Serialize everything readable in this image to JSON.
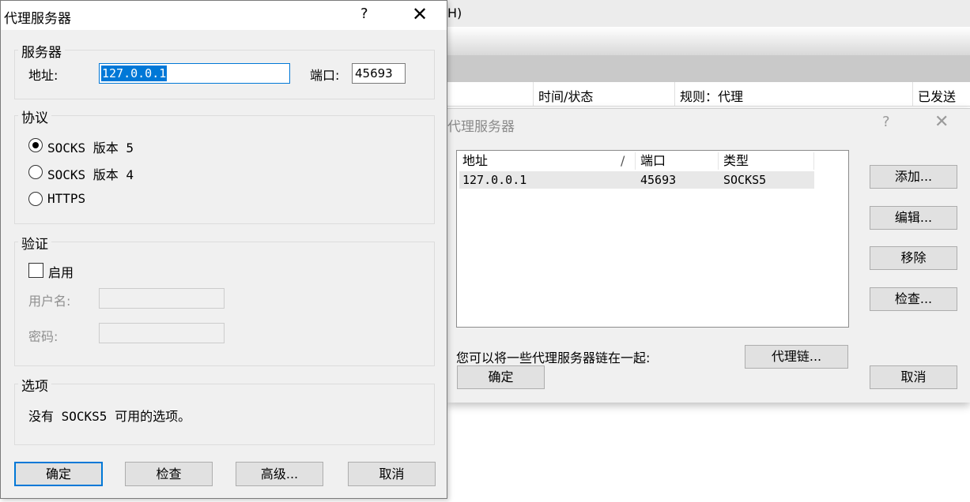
{
  "background_app": {
    "title_fragment": "H)",
    "columns": [
      "时间/状态",
      "规则：代理",
      "已发送"
    ]
  },
  "proxy_list_dialog": {
    "title": "代理服务器",
    "help_icon": "?",
    "close_icon": "✕",
    "table": {
      "headers": [
        "地址",
        "/",
        "端口",
        "类型"
      ],
      "rows": [
        {
          "address": "127.0.0.1",
          "port": "45693",
          "type": "SOCKS5"
        }
      ]
    },
    "buttons": {
      "add": "添加...",
      "edit": "编辑...",
      "remove": "移除",
      "check": "检查..."
    },
    "chain_text": "您可以将一些代理服务器链在一起:",
    "chain_button": "代理链...",
    "ok": "确定",
    "cancel": "取消"
  },
  "proxy_server_dialog": {
    "title": "代理服务器",
    "help_icon": "?",
    "close_icon": "✕",
    "server_group": {
      "legend": "服务器",
      "address_label": "地址:",
      "address_value": "127.0.0.1",
      "port_label": "端口:",
      "port_value": "45693"
    },
    "protocol_group": {
      "legend": "协议",
      "options": [
        "SOCKS 版本 5",
        "SOCKS 版本 4",
        "HTTPS"
      ],
      "selected": "SOCKS 版本 5"
    },
    "auth_group": {
      "legend": "验证",
      "enable_label": "启用",
      "enabled": false,
      "username_label": "用户名:",
      "password_label": "密码:"
    },
    "options_group": {
      "legend": "选项",
      "text": "没有 SOCKS5 可用的选项。"
    },
    "buttons": {
      "ok": "确定",
      "check": "检查",
      "advanced": "高级...",
      "cancel": "取消"
    }
  }
}
